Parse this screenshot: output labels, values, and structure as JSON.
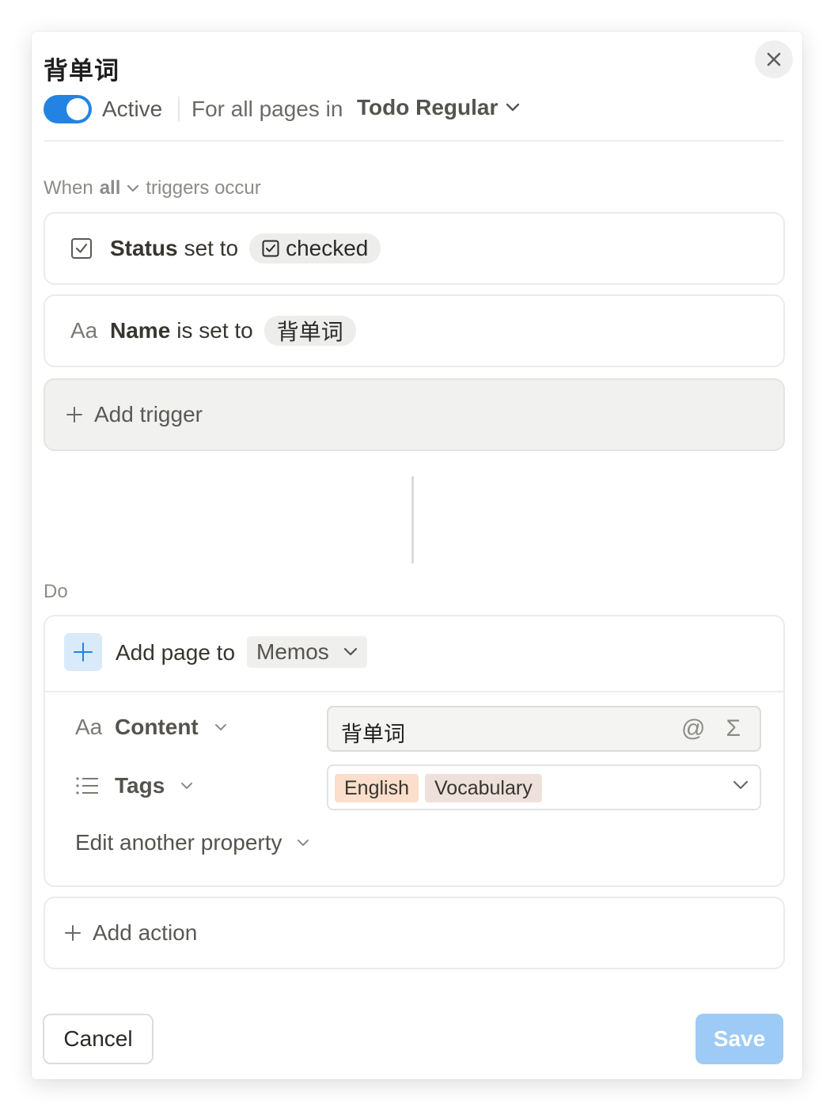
{
  "dialog": {
    "title": "背单词",
    "close_icon": "close-icon"
  },
  "status": {
    "active_label": "Active",
    "active": true,
    "scope_label": "For all pages in",
    "database": "Todo Regular",
    "accent": "#2383e2"
  },
  "triggers": {
    "when_label": "When",
    "mode": "all",
    "suffix": "triggers occur",
    "items": [
      {
        "icon": "checkbox-icon",
        "property": "Status",
        "verb": "set to",
        "value": "checked"
      },
      {
        "icon": "text-icon",
        "icon_text": "Aa",
        "property": "Name",
        "verb": "is set to",
        "value": "背单词"
      }
    ],
    "add_label": "Add trigger"
  },
  "actions": {
    "do_label": "Do",
    "action": {
      "label": "Add page to",
      "target": "Memos",
      "properties": [
        {
          "icon_text": "Aa",
          "name": "Content",
          "value": "背单词"
        },
        {
          "name": "Tags",
          "tags": [
            "English",
            "Vocabulary"
          ]
        }
      ],
      "edit_another": "Edit another property"
    },
    "add_label": "Add action"
  },
  "footer": {
    "cancel": "Cancel",
    "save": "Save"
  }
}
